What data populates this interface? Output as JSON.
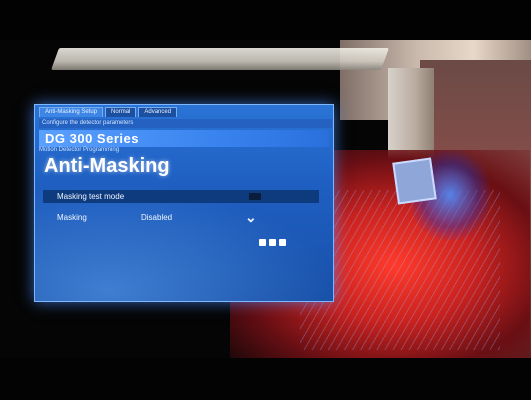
{
  "panel": {
    "tabs": [
      {
        "label": "Anti-Masking Setup"
      },
      {
        "label": "Normal"
      },
      {
        "label": "Advanced"
      }
    ],
    "subtitle": "Configure the detector parameters",
    "model": "DG 300 Series",
    "model_sub": "Motion Detector Programming",
    "title": "Anti-Masking",
    "rows": [
      {
        "label": "Masking test mode",
        "value": ""
      },
      {
        "label": "Masking",
        "value": "Disabled"
      }
    ]
  },
  "colors": {
    "panel_blue": "#1f5fc2",
    "panel_border": "#7fb6ff",
    "glow_red": "#ff3a2a"
  },
  "icons": [
    "chevron-down-icon",
    "nav-icon-1",
    "nav-icon-2",
    "nav-icon-3"
  ]
}
